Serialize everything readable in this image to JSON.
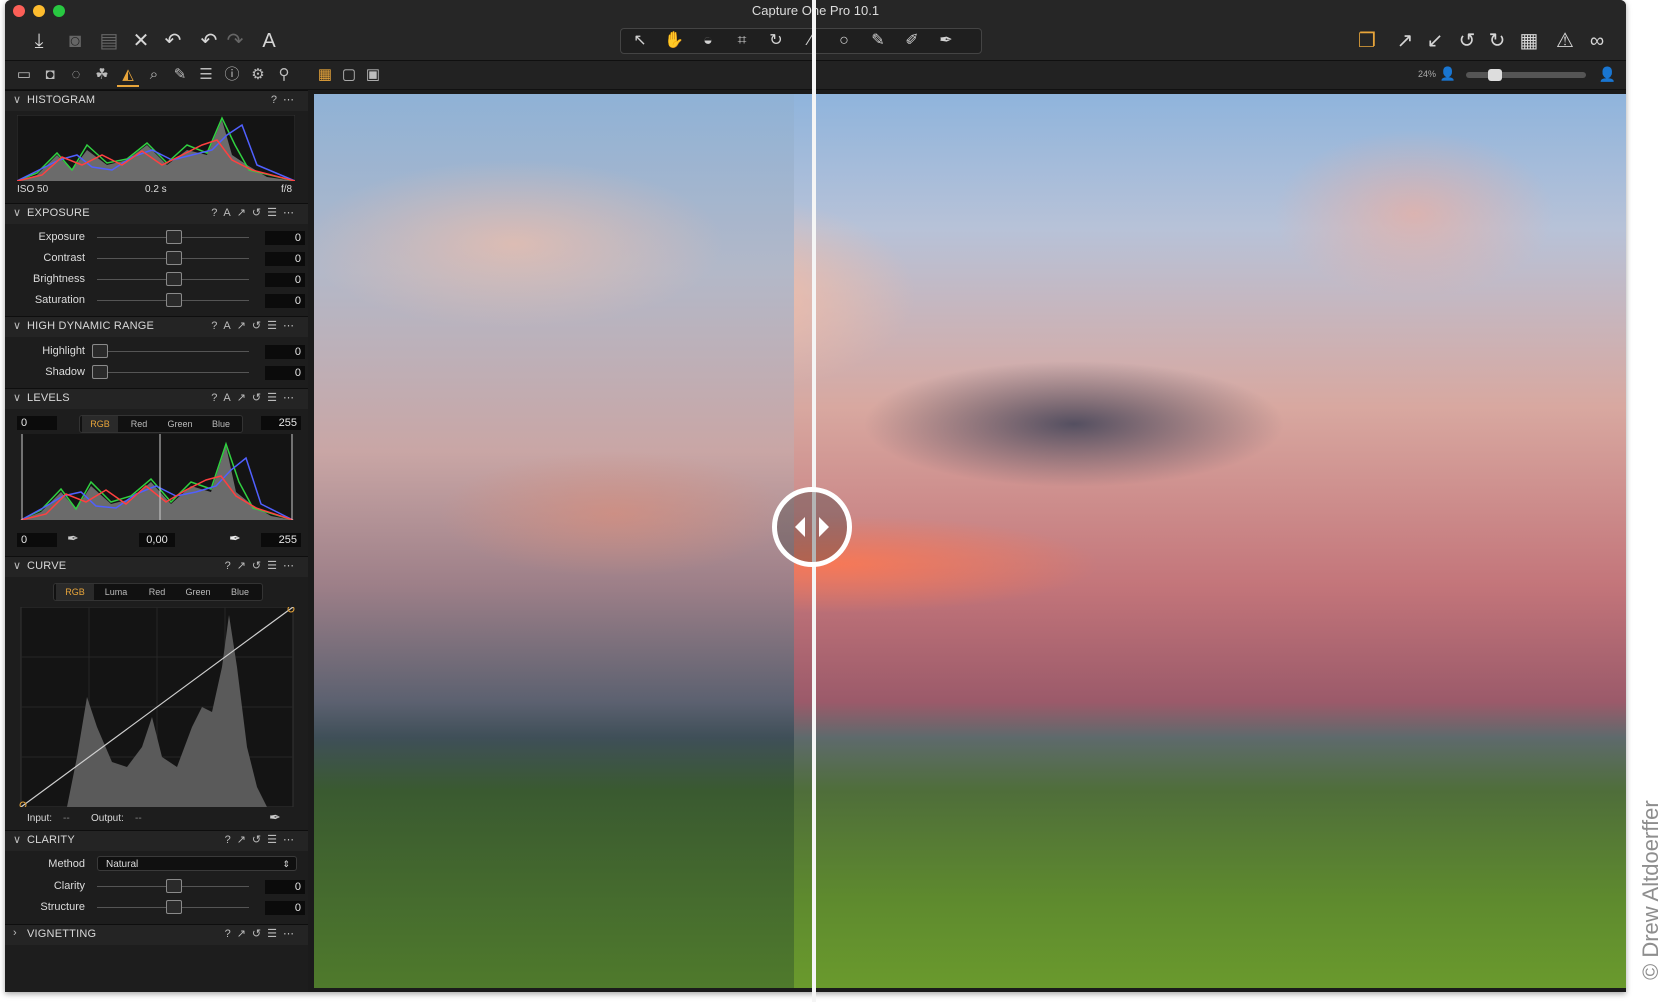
{
  "app": {
    "title": "Capture One Pro 10.1",
    "zoom_label": "24%",
    "credit": "© Drew Altdoerffer"
  },
  "colors": {
    "accent": "#e8a53a",
    "close": "#fc5f57",
    "minimize": "#fdbc2e",
    "zoom": "#28c841",
    "panel_bg": "#1d1d1d"
  },
  "toolbar": {
    "left_icons": [
      "import-icon",
      "capture-icon",
      "camera-icon",
      "delete-icon",
      "undo-icon",
      "undo-icon-2",
      "redo-icon",
      "text-icon"
    ],
    "cursor_tools": [
      "select-icon",
      "pan-icon",
      "loupe-icon",
      "crop-icon",
      "rotate-icon",
      "straighten-icon",
      "spot-icon",
      "brush-icon",
      "eraser-icon",
      "picker-icon"
    ],
    "right_icons": [
      "stack-icon",
      "expand-icon",
      "collapse-icon",
      "rotate-left-icon",
      "rotate-right-icon",
      "grid-icon",
      "warning-icon",
      "glasses-icon"
    ]
  },
  "tabs": {
    "icons": [
      "folder-icon",
      "camera-icon",
      "lens-icon",
      "color-icon",
      "exposure-icon",
      "search-icon",
      "pencil-icon",
      "list-icon",
      "info-icon",
      "gear-icon",
      "pipeline-icon"
    ],
    "active_index": 4
  },
  "viewer_modes": [
    "grid-view-icon",
    "single-view-icon",
    "compare-view-icon"
  ],
  "histogram": {
    "title": "HISTOGRAM",
    "iso": "ISO 50",
    "shutter": "0.2 s",
    "aperture": "f/8"
  },
  "exposure": {
    "title": "EXPOSURE",
    "rows": [
      {
        "label": "Exposure",
        "value": "0"
      },
      {
        "label": "Contrast",
        "value": "0"
      },
      {
        "label": "Brightness",
        "value": "0"
      },
      {
        "label": "Saturation",
        "value": "0"
      }
    ]
  },
  "hdr": {
    "title": "HIGH DYNAMIC RANGE",
    "rows": [
      {
        "label": "Highlight",
        "value": "0"
      },
      {
        "label": "Shadow",
        "value": "0"
      }
    ]
  },
  "levels": {
    "title": "LEVELS",
    "low": "0",
    "high": "255",
    "mid": "0,00",
    "low_out": "0",
    "high_out": "255",
    "channels": [
      "RGB",
      "Red",
      "Green",
      "Blue"
    ]
  },
  "curve": {
    "title": "CURVE",
    "channels": [
      "RGB",
      "Luma",
      "Red",
      "Green",
      "Blue"
    ],
    "input_label": "Input:",
    "input_value": "--",
    "output_label": "Output:",
    "output_value": "--"
  },
  "clarity": {
    "title": "CLARITY",
    "method_label": "Method",
    "method_value": "Natural",
    "rows": [
      {
        "label": "Clarity",
        "value": "0"
      },
      {
        "label": "Structure",
        "value": "0"
      }
    ]
  },
  "vignetting": {
    "title": "VIGNETTING"
  }
}
